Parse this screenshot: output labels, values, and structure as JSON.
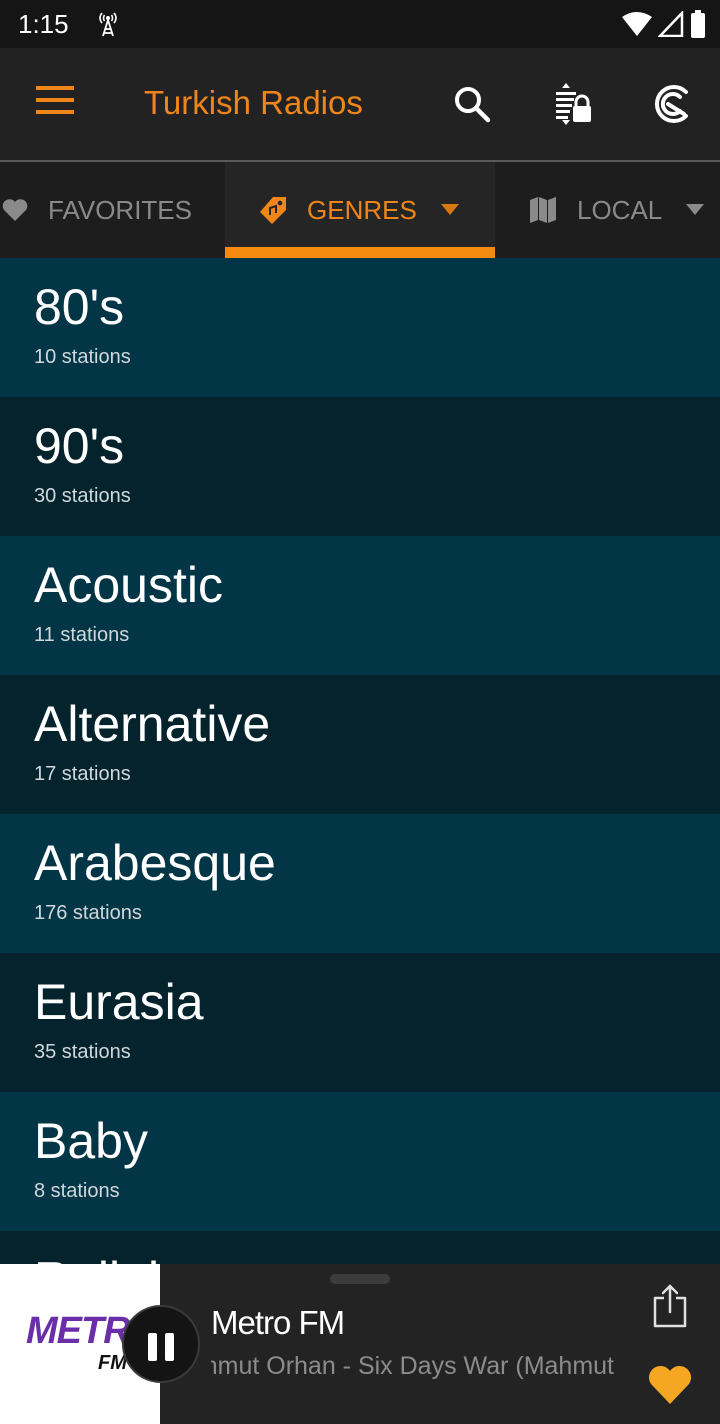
{
  "status_bar": {
    "time": "1:15",
    "icons": [
      "radio-tower-icon",
      "wifi-icon",
      "cell-signal-icon",
      "battery-icon"
    ]
  },
  "app_bar": {
    "title": "Turkish Radios",
    "icons": [
      "menu-icon",
      "search-icon",
      "sort-lock-icon",
      "cast-icon"
    ]
  },
  "tabs": [
    {
      "label": "FAVORITES",
      "icon": "heart-icon",
      "active": false
    },
    {
      "label": "GENRES",
      "icon": "music-tag-icon",
      "active": true,
      "dropdown": true
    },
    {
      "label": "LOCAL",
      "icon": "map-icon",
      "active": false,
      "dropdown": true
    }
  ],
  "genres": [
    {
      "name": "80's",
      "count": "10 stations"
    },
    {
      "name": "90's",
      "count": "30 stations"
    },
    {
      "name": "Acoustic",
      "count": "11 stations"
    },
    {
      "name": "Alternative",
      "count": "17 stations"
    },
    {
      "name": "Arabesque",
      "count": "176 stations"
    },
    {
      "name": "Eurasia",
      "count": "35 stations"
    },
    {
      "name": "Baby",
      "count": "8 stations"
    },
    {
      "name": "Religious",
      "count": ""
    }
  ],
  "player": {
    "logo_text": "METRO",
    "logo_sub": "FM",
    "station": "Metro FM",
    "track": "Mahmut Orhan - Six Days War (Mahmut Orhan Remix)",
    "state": "playing",
    "favorite": true,
    "colors": {
      "favorite": "#f5a623",
      "accent": "#f0861a"
    }
  }
}
